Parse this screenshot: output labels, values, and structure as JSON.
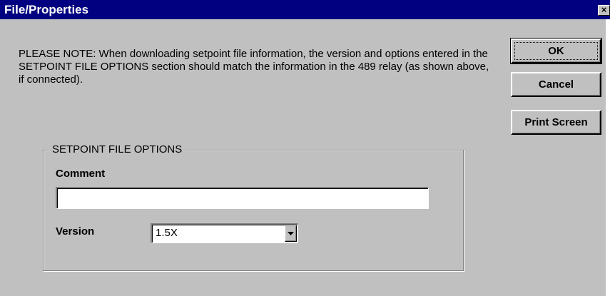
{
  "window": {
    "title": "File/Properties",
    "close_glyph": "×"
  },
  "note": {
    "text": "PLEASE NOTE:  When downloading setpoint file information, the version and options entered in the SETPOINT FILE OPTIONS section should match the information in the 489 relay (as shown above, if connected)."
  },
  "buttons": {
    "ok_label": "OK",
    "cancel_label": "Cancel",
    "print_label": "Print Screen"
  },
  "options": {
    "group_title": "SETPOINT FILE OPTIONS",
    "comment_label": "Comment",
    "comment_value": "",
    "version_label": "Version",
    "version_value": "1.5X"
  },
  "icons": {
    "close": "close-icon",
    "dropdown": "chevron-down-icon"
  },
  "colors": {
    "titlebar": "#000080",
    "face": "#c0c0c0"
  }
}
